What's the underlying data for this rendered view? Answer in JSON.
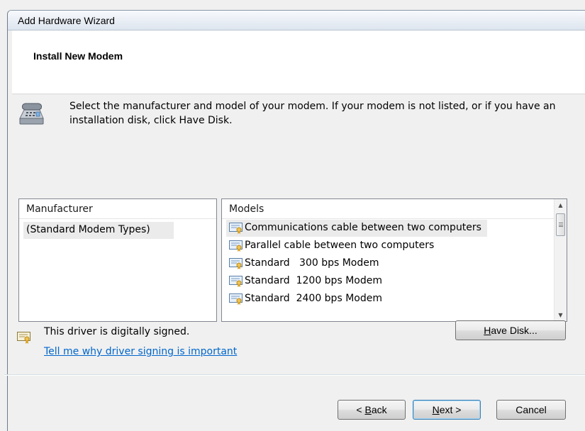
{
  "window": {
    "title": "Add Hardware Wizard"
  },
  "header": {
    "heading": "Install New Modem"
  },
  "instructions": "Select the manufacturer and model of your modem. If your modem is not listed, or if you have an installation disk, click Have Disk.",
  "manufacturer": {
    "header": "Manufacturer",
    "items": [
      {
        "label": "(Standard Modem Types)",
        "selected": true
      }
    ]
  },
  "models": {
    "header": "Models",
    "items": [
      {
        "label": "Communications cable between two computers",
        "selected": true
      },
      {
        "label": "Parallel cable between two computers",
        "selected": false
      },
      {
        "label": "Standard   300 bps Modem",
        "selected": false
      },
      {
        "label": "Standard  1200 bps Modem",
        "selected": false
      },
      {
        "label": "Standard  2400 bps Modem",
        "selected": false
      }
    ]
  },
  "signing": {
    "status_text": "This driver is digitally signed.",
    "link_text": "Tell me why driver signing is important"
  },
  "buttons": {
    "have_disk": {
      "prefix": "",
      "accel": "H",
      "rest": "ave Disk..."
    },
    "back": {
      "prefix": "< ",
      "accel": "B",
      "rest": "ack"
    },
    "next": {
      "prefix": "",
      "accel": "N",
      "rest": "ext >"
    },
    "cancel": "Cancel"
  },
  "icons": {
    "modem": "modem-phone-icon",
    "certificate": "signed-driver-certificate-icon",
    "scroll_up": "scroll-up-arrow-icon",
    "scroll_down": "scroll-down-arrow-icon"
  },
  "colors": {
    "link": "#0066cc",
    "selection": "#ebebeb",
    "header_bg": "#ffffff",
    "dialog_bg": "#f0f0f0"
  }
}
